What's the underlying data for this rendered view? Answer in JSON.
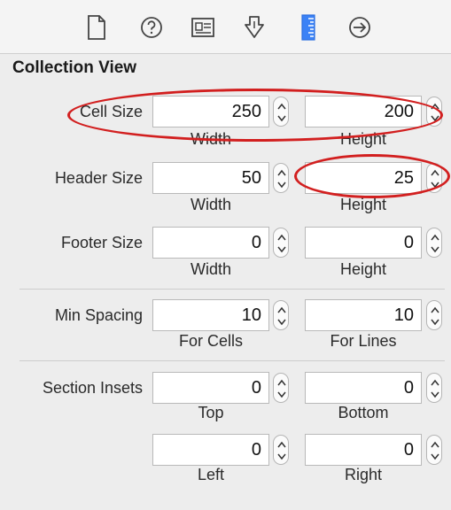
{
  "toolbar": {
    "icons": [
      "file-icon",
      "help-icon",
      "identity-icon",
      "attributes-icon",
      "size-icon",
      "connections-icon"
    ],
    "active": "size-icon",
    "accent": "#3b82f6"
  },
  "section_title": "Collection View",
  "rows": {
    "cell_size": {
      "label": "Cell Size",
      "a": "250",
      "b": "200",
      "sub_a": "Width",
      "sub_b": "Height"
    },
    "header_size": {
      "label": "Header Size",
      "a": "50",
      "b": "25",
      "sub_a": "Width",
      "sub_b": "Height"
    },
    "footer_size": {
      "label": "Footer Size",
      "a": "0",
      "b": "0",
      "sub_a": "Width",
      "sub_b": "Height"
    },
    "min_spacing": {
      "label": "Min Spacing",
      "a": "10",
      "b": "10",
      "sub_a": "For Cells",
      "sub_b": "For Lines"
    },
    "section_insets": {
      "label": "Section Insets",
      "a": "0",
      "b": "0",
      "sub_a": "Top",
      "sub_b": "Bottom",
      "c": "0",
      "d": "0",
      "sub_c": "Left",
      "sub_d": "Right"
    }
  },
  "annotation_color": "#d21f1f"
}
